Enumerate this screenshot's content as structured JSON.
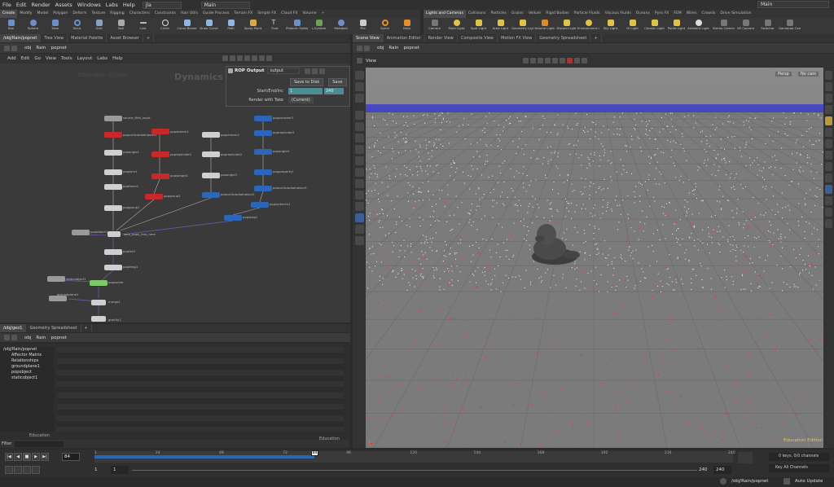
{
  "menubar": {
    "items": [
      "File",
      "Edit",
      "Render",
      "Assets",
      "Windows",
      "Labs",
      "Help"
    ],
    "file_name": "jla",
    "desktop": "Main",
    "right_desktop": "Main"
  },
  "shelf_left": {
    "tabs": [
      "Create",
      "Modify",
      "Model",
      "Polygon",
      "Deform",
      "Texture",
      "Rigging",
      "Characters",
      "Constraints",
      "Hair Utils",
      "Guide Process",
      "Terrain FX",
      "Simple FX",
      "Cloud FX",
      "Volume"
    ],
    "tools": [
      "Box",
      "Sphere",
      "Tube",
      "Torus",
      "Grid",
      "Null",
      "Line",
      "Circle",
      "Curve Bezier",
      "Draw Curve",
      "Path",
      "Spray Paint",
      "Font",
      "Platonic Solids",
      "L-System",
      "Metaball",
      "File",
      "Spiral",
      "Helix"
    ]
  },
  "shelf_right": {
    "tabs": [
      "Lights and Cameras",
      "Collisions",
      "Particles",
      "Grains",
      "Vellum",
      "Rigid Bodies",
      "Particle Fluids",
      "Viscous Fluids",
      "Oceans",
      "Pyro FX",
      "FEM",
      "Wires",
      "Crowds",
      "Drive Simulation"
    ],
    "tools": [
      "Camera",
      "Point Light",
      "Spot Light",
      "Area Light",
      "Geometry Light",
      "Volume Light",
      "Distant Light",
      "Environment Light",
      "Sky Light",
      "GI Light",
      "Caustic Light",
      "Portal Light",
      "Ambient Light",
      "Stereo Camera",
      "VR Camera",
      "Switcher",
      "Gamepad Camera"
    ]
  },
  "left_pane": {
    "tabs": [
      "/obj/Rain/popnet",
      "Tree View",
      "Material Palette",
      "Asset Browser"
    ],
    "path": [
      "obj",
      "Rain",
      "popnet"
    ],
    "menu": [
      "Add",
      "Edit",
      "Go",
      "View",
      "Tools",
      "Layout",
      "Labs",
      "Help"
    ],
    "watermark_edu": "Education Edition",
    "watermark_ctx": "Dynamics"
  },
  "rop": {
    "title": "ROP Output",
    "name_value": "output",
    "save_to_disk": "Save to Disk",
    "save_bg": "Save",
    "start_end_label": "Start/End/Inc",
    "start_value": "1",
    "end_value": "240",
    "render_take_label": "Render with Take",
    "take_value": "(Current)"
  },
  "network": {
    "nodes": [
      {
        "label": "source_first_input"
      },
      {
        "label": "popcollisionbehavior1"
      },
      {
        "label": "popangle1"
      },
      {
        "label": "popwire1"
      },
      {
        "label": "popforce1"
      },
      {
        "label": "popgroup1"
      },
      {
        "label": "popstream1"
      },
      {
        "label": "popreplicate1"
      },
      {
        "label": "popsangle1"
      },
      {
        "label": "popgroup2"
      },
      {
        "label": "popstream2"
      },
      {
        "label": "popreplicate2"
      },
      {
        "label": "popangle3"
      },
      {
        "label": "popcollisionbehavior2"
      },
      {
        "label": "popsstream3"
      },
      {
        "label": "popreplicate3"
      },
      {
        "label": "popangle4"
      },
      {
        "label": "popproperty1"
      },
      {
        "label": "popcollisionbehavior3"
      },
      {
        "label": "popsinterrm1"
      },
      {
        "label": "popdrag1"
      },
      {
        "label": "popobject1"
      },
      {
        "label": "zero_pops_into_here"
      },
      {
        "label": "popfall1"
      },
      {
        "label": "popsolver"
      },
      {
        "label": "staticobject1"
      },
      {
        "label": "popdrag1"
      },
      {
        "label": "groundplane1"
      },
      {
        "label": "merge1"
      },
      {
        "label": "gravity1"
      }
    ]
  },
  "bottom_left": {
    "tabs": [
      "/obj/geo1",
      "Geometry Spreadsheet"
    ],
    "path": [
      "obj",
      "Rain",
      "popnet"
    ],
    "tree": [
      "/obj/Rain/popnet",
      "Affector Matrix",
      "Relationships",
      "groundplane1",
      "popobject",
      "staticobject1"
    ],
    "edu_label": "Education",
    "edu_label2": "Education",
    "filter_label": "Filter"
  },
  "right_pane": {
    "tabs": [
      "Scene View",
      "Animation Editor",
      "Render View",
      "Composite View",
      "Motion FX View",
      "Geometry Spreadsheet"
    ],
    "path": [
      "obj",
      "Rain",
      "popnet"
    ],
    "view_label": "View",
    "persp": "Persp",
    "cam": "No cam",
    "edu": "Education Edition"
  },
  "timeline": {
    "frame": "84",
    "ticks": [
      "1",
      "24",
      "48",
      "72",
      "96",
      "120",
      "144",
      "168",
      "192",
      "216",
      "240"
    ],
    "current_marker": "84",
    "range_start": "1",
    "range_start2": "1",
    "range_end": "240",
    "range_end2": "240",
    "keys_label": "0 keys, 0/0 channels",
    "key_all": "Key All Channels"
  },
  "statusbar": {
    "path": "/obj/Rain/popnet",
    "auto_update": "Auto Update"
  },
  "colors": {
    "node_red": "#c8282a",
    "node_blue": "#2c66b8",
    "timeline_blue": "#2a67b5",
    "viewport_grey": "#7d7d7d"
  }
}
